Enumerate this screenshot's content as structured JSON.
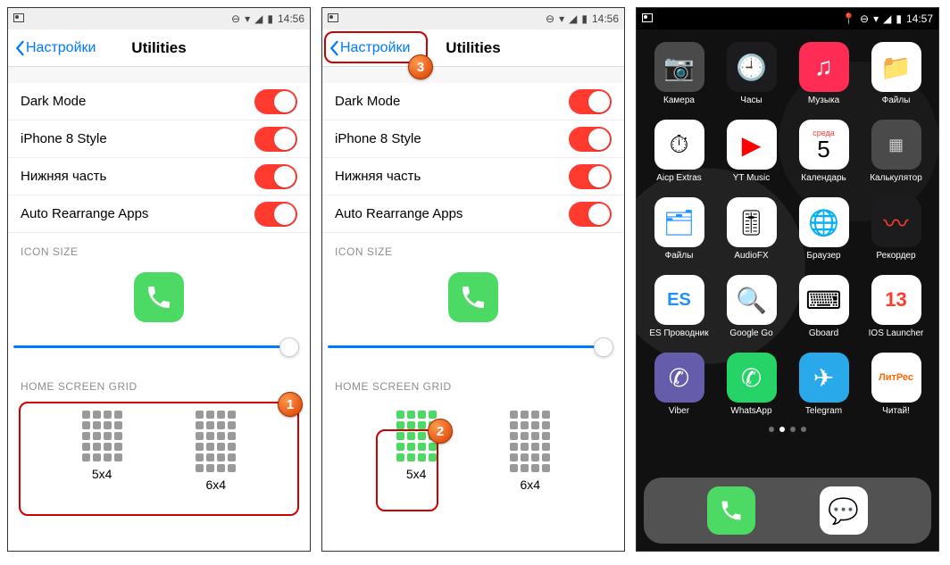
{
  "status": {
    "time_light": "14:56",
    "time_dark": "14:57"
  },
  "nav": {
    "back": "Настройки",
    "title": "Utilities"
  },
  "toggles": [
    {
      "label": "Dark Mode"
    },
    {
      "label": "iPhone 8 Style"
    },
    {
      "label": "Нижняя часть"
    },
    {
      "label": "Auto Rearrange Apps"
    }
  ],
  "sections": {
    "icon_size": "ICON SIZE",
    "home_grid": "HOME SCREEN GRID"
  },
  "grid": {
    "opt1": "5x4",
    "opt2": "6x4"
  },
  "apps": [
    {
      "name": "Камера"
    },
    {
      "name": "Часы"
    },
    {
      "name": "Музыка"
    },
    {
      "name": "Файлы"
    },
    {
      "name": "Aicp Extras"
    },
    {
      "name": "YT Music"
    },
    {
      "name": "Календарь"
    },
    {
      "name": "Калькулятор"
    },
    {
      "name": "Файлы"
    },
    {
      "name": "AudioFX"
    },
    {
      "name": "Браузер"
    },
    {
      "name": "Рекордер"
    },
    {
      "name": "ES Проводник"
    },
    {
      "name": "Google Go"
    },
    {
      "name": "Gboard"
    },
    {
      "name": "IOS Launcher"
    },
    {
      "name": "Viber"
    },
    {
      "name": "WhatsApp"
    },
    {
      "name": "Telegram"
    },
    {
      "name": "Читай!"
    }
  ],
  "calendar": {
    "dow": "среда",
    "day": "5"
  },
  "callouts": {
    "c1": "1",
    "c2": "2",
    "c3": "3"
  }
}
